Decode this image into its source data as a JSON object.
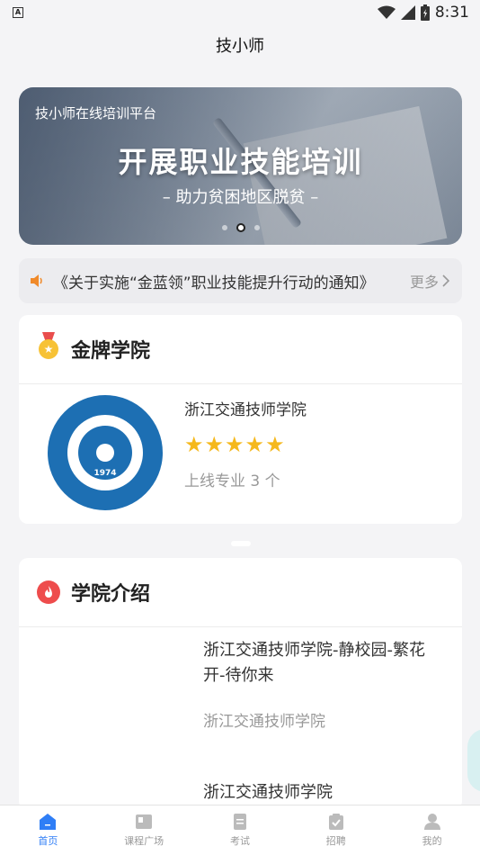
{
  "status_bar": {
    "time": "8:31",
    "notification_glyph": "A"
  },
  "header": {
    "title": "技小师"
  },
  "banner": {
    "subtitle": "技小师在线培训平台",
    "title": "开展职业技能培训",
    "tagline": "– 助力贫困地区脱贫 –",
    "dot_count": 3,
    "active_dot": 2
  },
  "notice": {
    "icon": "speaker-icon",
    "text": "《关于实施“金蓝领”职业技能提升行动的通知》",
    "more_label": "更多"
  },
  "gold_college": {
    "section_title": "金牌学院",
    "icon": "medal-icon",
    "college": {
      "name": "浙江交通技师学院",
      "rating": 5,
      "stars": "★★★★★",
      "courses_label": "上线专业 3 个",
      "logo_year": "1974"
    }
  },
  "college_intro": {
    "section_title": "学院介绍",
    "icon": "fire-icon",
    "items": [
      {
        "title": "浙江交通技师学院-静校园-繁花开-待你来",
        "source": "浙江交通技师学院"
      },
      {
        "title": "浙江交通技师学院"
      }
    ]
  },
  "tab_bar": {
    "tabs": [
      {
        "label": "首页",
        "icon": "home-icon",
        "active": true
      },
      {
        "label": "课程广场",
        "icon": "course-icon",
        "active": false
      },
      {
        "label": "考试",
        "icon": "exam-icon",
        "active": false
      },
      {
        "label": "招聘",
        "icon": "recruit-icon",
        "active": false
      },
      {
        "label": "我的",
        "icon": "profile-icon",
        "active": false
      }
    ]
  },
  "colors": {
    "accent": "#2f7ef6",
    "star": "#f5b81c",
    "notice_icon": "#f08a2a",
    "fire": "#ee4c4c"
  }
}
